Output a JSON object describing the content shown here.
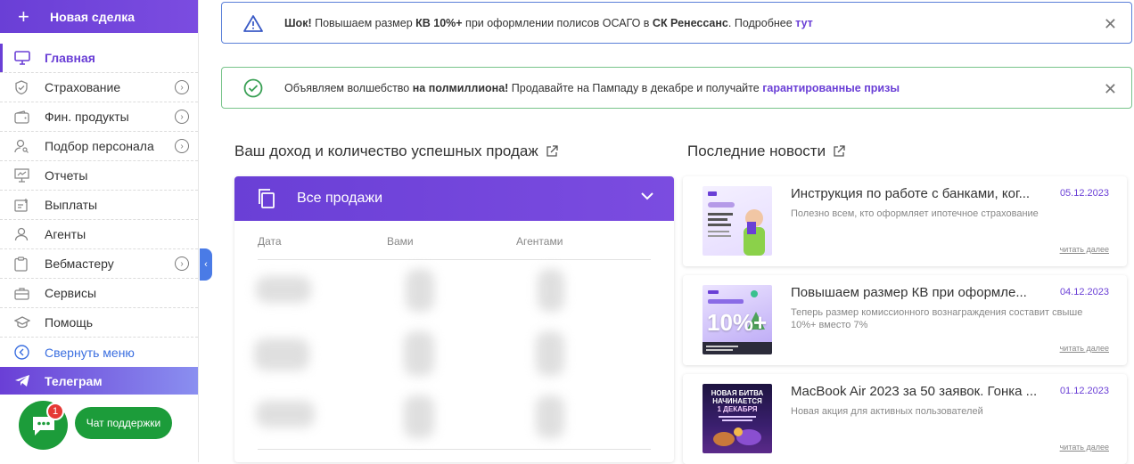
{
  "sidebar": {
    "new_deal": "Новая сделка",
    "items": [
      {
        "label": "Главная"
      },
      {
        "label": "Страхование"
      },
      {
        "label": "Фин. продукты"
      },
      {
        "label": "Подбор персонала"
      },
      {
        "label": "Отчеты"
      },
      {
        "label": "Выплаты"
      },
      {
        "label": "Агенты"
      },
      {
        "label": "Вебмастеру"
      },
      {
        "label": "Сервисы"
      },
      {
        "label": "Помощь"
      },
      {
        "label": "Свернуть меню"
      },
      {
        "label": "Телеграм"
      }
    ]
  },
  "chat": {
    "badge": "1",
    "support_label": "Чат поддержки"
  },
  "alerts": {
    "blue": {
      "b1": "Шок!",
      "t1": " Повышаем размер ",
      "b2": "КВ 10%+",
      "t2": " при оформлении полисов ОСАГО в ",
      "b3": "СК Ренессанс",
      "t3": ". Подробнее ",
      "link": "тут"
    },
    "green": {
      "t1": "Объявляем волшебство ",
      "b1": "на полмиллиона!",
      "t2": " Продавайте на Пампаду в декабре и получайте ",
      "link": "гарантированные призы"
    }
  },
  "income": {
    "title": "Ваш доход и количество успешных продаж",
    "dropdown": "Все продажи",
    "columns": [
      "Дата",
      "Вами",
      "Агентами"
    ]
  },
  "news": {
    "title": "Последние новости",
    "items": [
      {
        "title": "Инструкция по работе с банками, ког...",
        "date": "05.12.2023",
        "desc": "Полезно всем, кто оформляет ипотечное страхование",
        "more": "читать далее"
      },
      {
        "title": "Повышаем размер КВ при оформле...",
        "date": "04.12.2023",
        "desc": "Теперь размер комиссионного вознаграждения составит свыше 10%+ вместо 7%",
        "more": "читать далее"
      },
      {
        "title": "MacBook Air 2023 за 50 заявок. Гонка ...",
        "date": "01.12.2023",
        "desc": "Новая акция для активных пользователей",
        "more": "читать далее"
      }
    ]
  },
  "thumbs": {
    "t2_big": "10%+",
    "t3_l1": "НОВАЯ БИТВА",
    "t3_l2": "НАЧИНАЕТСЯ",
    "t3_l3": "1 ДЕКАБРЯ"
  },
  "colors": {
    "accent": "#6a3fd6",
    "blue": "#4a7be6",
    "green": "#1c9c3a"
  }
}
